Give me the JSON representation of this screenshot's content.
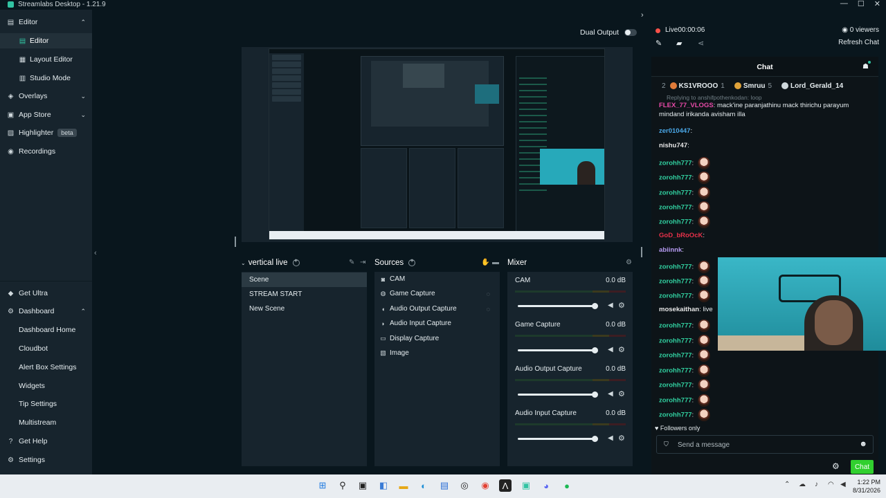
{
  "window": {
    "title": "Streamlabs Desktop - 1.21.9",
    "controls": [
      "—",
      "☐",
      "✕"
    ]
  },
  "sidebar": {
    "editor": "Editor",
    "editor_sub": [
      "Editor",
      "Layout Editor",
      "Studio Mode"
    ],
    "overlays": "Overlays",
    "app_store": "App Store",
    "highlighter": "Highlighter",
    "highlighter_badge": "beta",
    "recordings": "Recordings",
    "get_ultra": "Get Ultra",
    "dashboard": "Dashboard",
    "dashboard_sub": [
      "Dashboard Home",
      "Cloudbot",
      "Alert Box Settings",
      "Widgets",
      "Tip Settings",
      "Multistream"
    ],
    "get_help": "Get Help",
    "settings": "Settings"
  },
  "editor": {
    "dual_output": "Dual Output",
    "scenes": {
      "title": "vertical live",
      "items": [
        "Scene",
        "STREAM START",
        "New Scene"
      ]
    },
    "sources": {
      "title": "Sources",
      "items": [
        "CAM",
        "Game Capture",
        "Audio Output Capture",
        "Audio Input Capture",
        "Display Capture",
        "Image"
      ]
    },
    "mixer": {
      "title": "Mixer",
      "channels": [
        {
          "name": "CAM",
          "db": "0.0 dB"
        },
        {
          "name": "Game Capture",
          "db": "0.0 dB"
        },
        {
          "name": "Audio Output Capture",
          "db": "0.0 dB"
        },
        {
          "name": "Audio Input Capture",
          "db": "0.0 dB"
        }
      ]
    }
  },
  "live": {
    "status": "Live00:00:06",
    "viewers": "0 viewers",
    "refresh": "Refresh Chat"
  },
  "chat": {
    "title": "Chat",
    "leaderboard": [
      {
        "rank": "2",
        "name": "KS1VROOO",
        "count": "1",
        "color": "#e07b39"
      },
      {
        "rank": "",
        "name": "Smruu",
        "count": "5",
        "color": "#e0a33a"
      },
      {
        "rank": "",
        "name": "Lord_Gerald_14",
        "count": "",
        "color": "#cfd8dc"
      }
    ],
    "reply_note": "Replying to anshifpothenkodan: loop",
    "messages": [
      {
        "user": "FLEX_77_VLOGS",
        "color": "#e84aa8",
        "text": "mack'ine paranjathinu mack thirichu parayum mindand irikanda avisham illa"
      },
      {
        "user": "zer010447",
        "color": "#4aa8e8",
        "text": ""
      },
      {
        "user": "nishu747",
        "color": "#e8e8e8",
        "text": ""
      },
      {
        "user": "zorohh777",
        "color": "#31d0a0",
        "text": ""
      },
      {
        "user": "zorohh777",
        "color": "#31d0a0",
        "text": ""
      },
      {
        "user": "zorohh777",
        "color": "#31d0a0",
        "text": ""
      },
      {
        "user": "zorohh777",
        "color": "#31d0a0",
        "text": ""
      },
      {
        "user": "zorohh777",
        "color": "#31d0a0",
        "text": ""
      },
      {
        "user": "GoD_bRoOcK",
        "color": "#e8314a",
        "text": ""
      },
      {
        "user": "abiinnk",
        "color": "#b59af0",
        "text": ""
      },
      {
        "user": "zorohh777",
        "color": "#31d0a0",
        "text": ""
      },
      {
        "user": "zorohh777",
        "color": "#31d0a0",
        "text": ""
      },
      {
        "user": "zorohh777",
        "color": "#31d0a0",
        "text": ""
      },
      {
        "user": "mosekaithan",
        "color": "#e8e8e8",
        "text": "live"
      },
      {
        "user": "zorohh777",
        "color": "#31d0a0",
        "text": ""
      },
      {
        "user": "zorohh777",
        "color": "#31d0a0",
        "text": ""
      },
      {
        "user": "zorohh777",
        "color": "#31d0a0",
        "text": ""
      },
      {
        "user": "zorohh777",
        "color": "#31d0a0",
        "text": ""
      },
      {
        "user": "zorohh777",
        "color": "#31d0a0",
        "text": ""
      },
      {
        "user": "zorohh777",
        "color": "#31d0a0",
        "text": ""
      },
      {
        "user": "zorohh777",
        "color": "#31d0a0",
        "text": ""
      }
    ],
    "followers_only": "Followers only",
    "input_placeholder": "Send a message",
    "send_button": "Chat"
  },
  "taskbar": {
    "time": "1:22 PM",
    "date": "8/31/2026"
  },
  "colors": {
    "accent": "#31c3a2",
    "chat_button": "#31d02f",
    "live": "#f85149"
  }
}
